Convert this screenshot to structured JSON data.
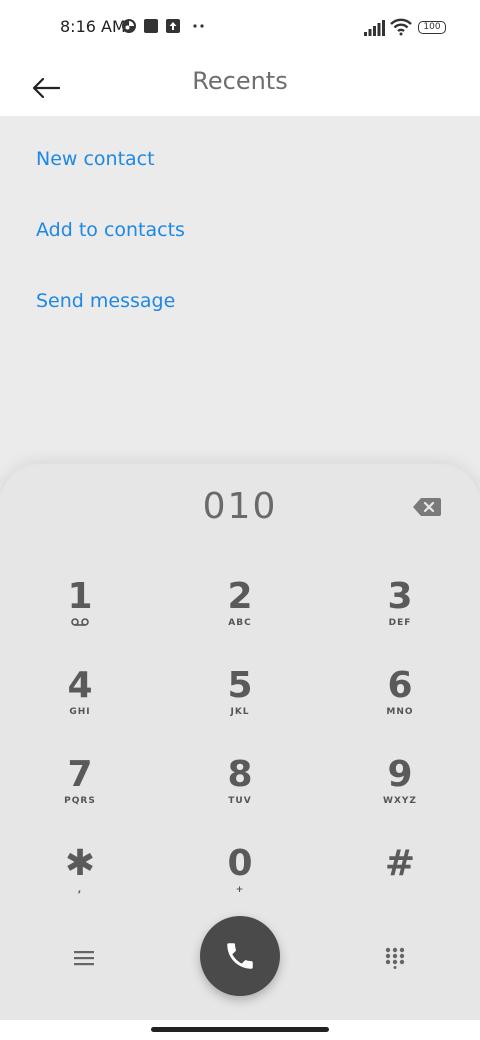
{
  "status_bar": {
    "time": "8:16 AM",
    "battery": "100"
  },
  "header": {
    "title": "Recents",
    "back_icon": "arrow-left-icon"
  },
  "actions": [
    {
      "label": "New contact"
    },
    {
      "label": "Add to contacts"
    },
    {
      "label": "Send message"
    }
  ],
  "dialer": {
    "number": "010",
    "keys": [
      {
        "digit": "1",
        "letters": ""
      },
      {
        "digit": "2",
        "letters": "ABC"
      },
      {
        "digit": "3",
        "letters": "DEF"
      },
      {
        "digit": "4",
        "letters": "GHI"
      },
      {
        "digit": "5",
        "letters": "JKL"
      },
      {
        "digit": "6",
        "letters": "MNO"
      },
      {
        "digit": "7",
        "letters": "PQRS"
      },
      {
        "digit": "8",
        "letters": "TUV"
      },
      {
        "digit": "9",
        "letters": "WXYZ"
      },
      {
        "digit": "✱",
        "letters": ","
      },
      {
        "digit": "0",
        "letters": "+"
      },
      {
        "digit": "#",
        "letters": ""
      }
    ]
  },
  "colors": {
    "link": "#1e88e5",
    "call_button": "#4a4a4a"
  }
}
